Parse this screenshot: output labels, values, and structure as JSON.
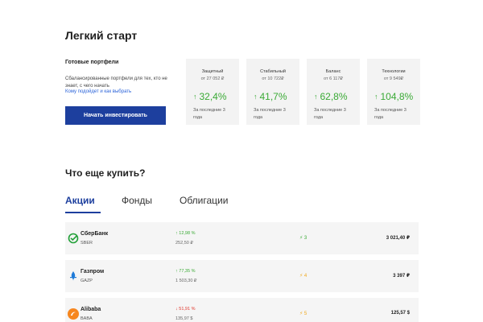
{
  "easy_start": {
    "title": "Легкий старт"
  },
  "ready": {
    "title": "Готовые портфели",
    "description": "Сбалансированные портфели для тех, кто не знает, с чего начать",
    "link": "Кому подойдет и как выбрать",
    "button": "Начать инвестировать"
  },
  "portfolios": [
    {
      "name": "Защитный",
      "from": "от 27 052 ₽",
      "value": "32,4%",
      "period": "За последние 3 года"
    },
    {
      "name": "Стабильный",
      "from": "от 10 722₽",
      "value": "41,7%",
      "period": "За последние 3 года"
    },
    {
      "name": "Баланс",
      "from": "от 6 117₽",
      "value": "62,8%",
      "period": "За последние 3 года"
    },
    {
      "name": "Технологии",
      "from": "от 9 549₽",
      "value": "104,8%",
      "period": "За последние 3 года"
    }
  ],
  "buy": {
    "title": "Что еще купить?"
  },
  "tabs": [
    {
      "label": "Акции",
      "active": true
    },
    {
      "label": "Фонды",
      "active": false
    },
    {
      "label": "Облигации",
      "active": false
    }
  ],
  "stocks": [
    {
      "name": "СберБанк",
      "ticker": "SBER",
      "change": "12,98 %",
      "direction": "up",
      "price": "252,50 ₽",
      "bolt": "3",
      "bolt_color": "green",
      "value": "3 021,40 ₽",
      "logo_color": "#21a038"
    },
    {
      "name": "Газпром",
      "ticker": "GAZP",
      "change": "77,35 %",
      "direction": "up",
      "price": "1 503,30 ₽",
      "bolt": "4",
      "bolt_color": "orange",
      "value": "3 397 ₽",
      "logo_color": "#1f7bd8"
    },
    {
      "name": "Alibaba",
      "ticker": "BABA",
      "change": "51,91 %",
      "direction": "down",
      "price": "135,97 $",
      "bolt": "5",
      "bolt_color": "orange",
      "value": "125,57 $",
      "logo_color": "#f6861f"
    }
  ]
}
